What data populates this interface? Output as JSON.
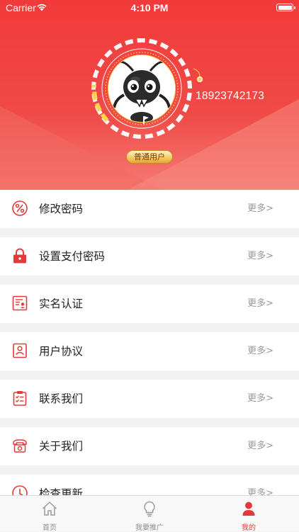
{
  "status_bar": {
    "carrier": "Carrier",
    "time": "4:10 PM"
  },
  "profile": {
    "phone": "18923742173",
    "badge": "普通用户",
    "accent_color": "#f23a3a",
    "badge_color": "#f6cf6e"
  },
  "menu": {
    "more_label": "更多>",
    "items": [
      {
        "label": "修改密码",
        "icon": "percent-icon"
      },
      {
        "label": "设置支付密码",
        "icon": "lock-icon"
      },
      {
        "label": "实名认证",
        "icon": "id-card-icon"
      },
      {
        "label": "用户协议",
        "icon": "user-agreement-icon"
      },
      {
        "label": "联系我们",
        "icon": "clipboard-icon"
      },
      {
        "label": "关于我们",
        "icon": "telephone-icon"
      },
      {
        "label": "检查更新",
        "icon": "update-icon"
      }
    ]
  },
  "tabbar": {
    "tabs": [
      {
        "label": "首页",
        "icon": "home-icon",
        "active": false
      },
      {
        "label": "我要推广",
        "icon": "lightbulb-icon",
        "active": false
      },
      {
        "label": "我的",
        "icon": "person-icon",
        "active": true
      }
    ],
    "active_color": "#e33b3b"
  }
}
